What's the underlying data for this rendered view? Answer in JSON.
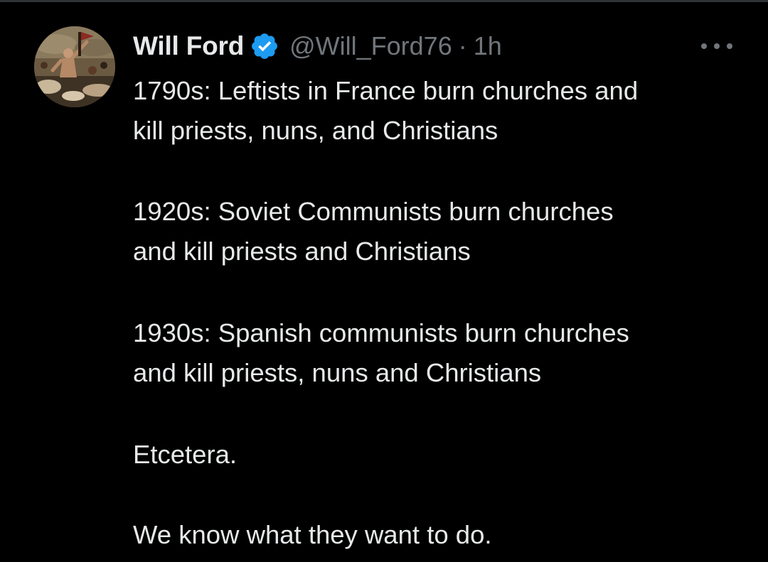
{
  "tweet": {
    "author": {
      "display_name": "Will Ford",
      "handle": "@Will_Ford76",
      "verified_icon": "verified-badge-icon",
      "avatar_icon": "avatar-painting-image"
    },
    "separator": "·",
    "timestamp": "1h",
    "more_icon": "more-horizontal-icon",
    "lines": [
      "1790s: Leftists in France burn churches and",
      "kill priests, nuns, and Christians",
      "1920s: Soviet Communists burn churches",
      "and kill priests and Christians",
      "1930s: Spanish communists burn churches",
      "and kill priests, nuns and Christians",
      "Etcetera.",
      "We know what they want to do."
    ]
  },
  "colors": {
    "background": "#000000",
    "text_primary": "#e7e9ea",
    "text_secondary": "#71767b",
    "verified_blue": "#1d9bf0",
    "divider": "#2f3336"
  }
}
